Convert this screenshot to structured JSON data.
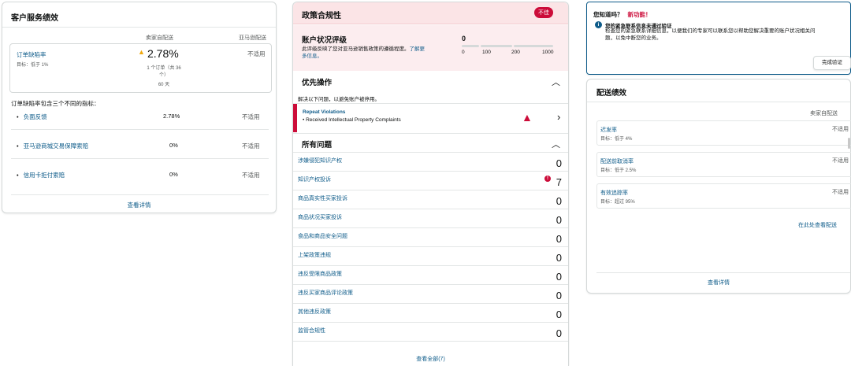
{
  "customer_service": {
    "title": "客户服务绩效",
    "col_seller": "卖家自配送",
    "col_amazon": "亚马逊配送",
    "defect_rate": {
      "label": "订单缺陷率",
      "target": "目标：低于 1%",
      "value": "2.78%",
      "detail_line1": "1 个订单（共 36",
      "detail_line2": "个）",
      "detail_line3": "60 天",
      "amazon_value": "不适用"
    },
    "subtitle": "订单缺陷率包含三个不同的指标：",
    "metrics": [
      {
        "label": "负面反馈",
        "value": "2.78%",
        "amazon": "不适用"
      },
      {
        "label": "亚马逊商城交易保障索赔",
        "value": "0%",
        "amazon": "不适用"
      },
      {
        "label": "信用卡拒付索赔",
        "value": "0%",
        "amazon": "不适用"
      }
    ],
    "view_details": "查看详情"
  },
  "policy": {
    "title": "政策合规性",
    "badge": "不佳",
    "health_title": "账户状况评级",
    "health_desc1": "此评级反映了您对亚马逊销售政策的遵循程度。",
    "health_more_a": "了解更",
    "health_more_b": "多信息。",
    "score": "0",
    "scale": [
      "0",
      "100",
      "200",
      "1000"
    ],
    "priority_title": "优先操作",
    "priority_desc": "解决以下问题，以避免账户被停用。",
    "violation_title": "Repeat Violations",
    "violation_item": "• Received Intellectual Property Complaints",
    "all_issues_title": "所有问题",
    "issues": [
      {
        "label": "涉嫌侵犯知识产权",
        "count": "0"
      },
      {
        "label": "知识产权投诉",
        "count": "7"
      },
      {
        "label": "商品真实性买家投诉",
        "count": "0"
      },
      {
        "label": "商品状况买家投诉",
        "count": "0"
      },
      {
        "label": "食品和商品安全问题",
        "count": "0"
      },
      {
        "label": "上架政策违规",
        "count": "0"
      },
      {
        "label": "违反受限商品政策",
        "count": "0"
      },
      {
        "label": "违反买家商品评论政策",
        "count": "0"
      },
      {
        "label": "其他违反政策",
        "count": "0"
      },
      {
        "label": "监管合规性",
        "count": "0"
      }
    ],
    "view_all": "查看全部(7)"
  },
  "tip": {
    "title": "您知道吗？",
    "new_label": "新功能！",
    "heading": "您的紧急联系信息未通过验证",
    "body1": "检查您的紧急联系详细信息，以便我们的专家可以联系您以帮助您解决重要的账户状况相关问",
    "body2": "题，以免中断您的业务。",
    "button": "完成验证"
  },
  "delivery": {
    "title": "配送绩效",
    "col_seller": "卖家自配送",
    "metrics": [
      {
        "label": "迟发率",
        "target": "目标：低于 4%",
        "value": "不适用"
      },
      {
        "label": "配送前取消率",
        "target": "目标：低于 2.5%",
        "value": "不适用"
      },
      {
        "label": "有效追踪率",
        "target": "目标：超过 95%",
        "value": "不适用"
      }
    ],
    "view_here": "在此处查看配送",
    "view_details": "查看详情"
  },
  "colors": {
    "link": "#0f5c8a",
    "alert_red": "#cc0c39",
    "warning_orange": "#f0a80e",
    "header_pink": "#fbe4e6"
  }
}
